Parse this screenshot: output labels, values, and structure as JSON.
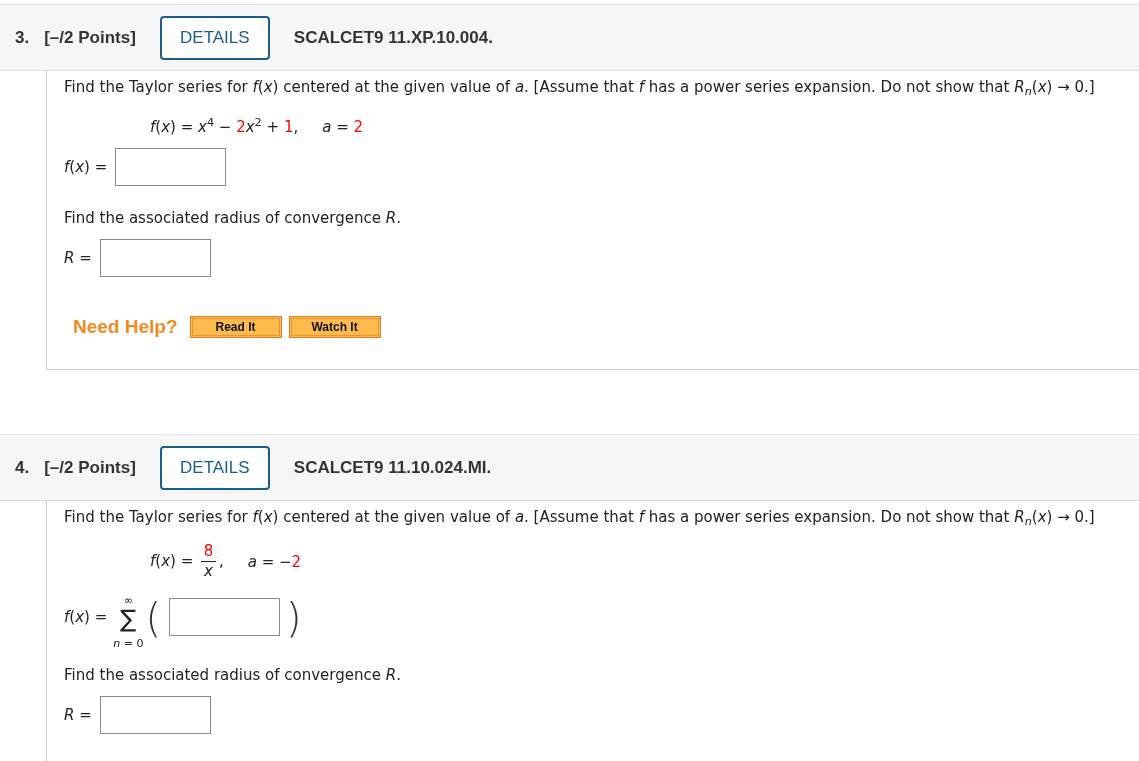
{
  "questions": [
    {
      "number": "3.",
      "points": "[–/2 Points]",
      "details": "DETAILS",
      "code": "SCALCET9 11.XP.10.004.",
      "parts": [
        {
          "kind": "prompt",
          "text": "Find the Taylor series for *f*(*x*) centered at the given value of *a*. [Assume that *f* has a power series expansion. Do not show that *R*$_{n}$(*x*) → 0.]"
        },
        {
          "kind": "given",
          "function": [
            {
              "kind": "math",
              "text": "*f*(*x*) = *x*$^{4}$ − "
            },
            {
              "kind": "value",
              "text": "2"
            },
            {
              "kind": "math",
              "text": "*x*$^{2}$ + "
            },
            {
              "kind": "value",
              "text": "1"
            },
            {
              "kind": "math",
              "text": ","
            }
          ],
          "center": [
            {
              "kind": "math",
              "text": "*a* = "
            },
            {
              "kind": "value",
              "text": "2"
            }
          ]
        },
        {
          "kind": "answer",
          "label": "*f*(*x*) ="
        },
        {
          "kind": "prompt",
          "text": "Find the associated radius of convergence *R*."
        },
        {
          "kind": "answer",
          "label": "*R* ="
        },
        {
          "kind": "help",
          "label": "Need Help?",
          "buttons": [
            "Read It",
            "Watch It"
          ]
        }
      ]
    },
    {
      "number": "4.",
      "points": "[–/2 Points]",
      "details": "DETAILS",
      "code": "SCALCET9 11.10.024.MI.",
      "parts": [
        {
          "kind": "prompt",
          "text": "Find the Taylor series for *f*(*x*) centered at the given value of *a*. [Assume that *f* has a power series expansion. Do not show that *R*$_{n}$(*x*) → 0.]"
        },
        {
          "kind": "given",
          "function": [
            {
              "kind": "math",
              "text": "*f*(*x*) = "
            },
            {
              "kind": "fraction",
              "numerator": {
                "kind": "value",
                "text": "8"
              },
              "denominator": {
                "kind": "math",
                "text": "*x*"
              }
            },
            {
              "kind": "math",
              "text": ","
            }
          ],
          "center": [
            {
              "kind": "math",
              "text": "*a* = −"
            },
            {
              "kind": "value",
              "text": "2"
            }
          ]
        },
        {
          "kind": "series_answer",
          "label": "*f*(*x*) =",
          "upper": "∞",
          "symbol": "∑",
          "lower": "*n* = 0",
          "open": "(",
          "close": ")"
        },
        {
          "kind": "prompt",
          "text": "Find the associated radius of convergence *R*."
        },
        {
          "kind": "answer",
          "label": "*R* ="
        }
      ]
    }
  ]
}
